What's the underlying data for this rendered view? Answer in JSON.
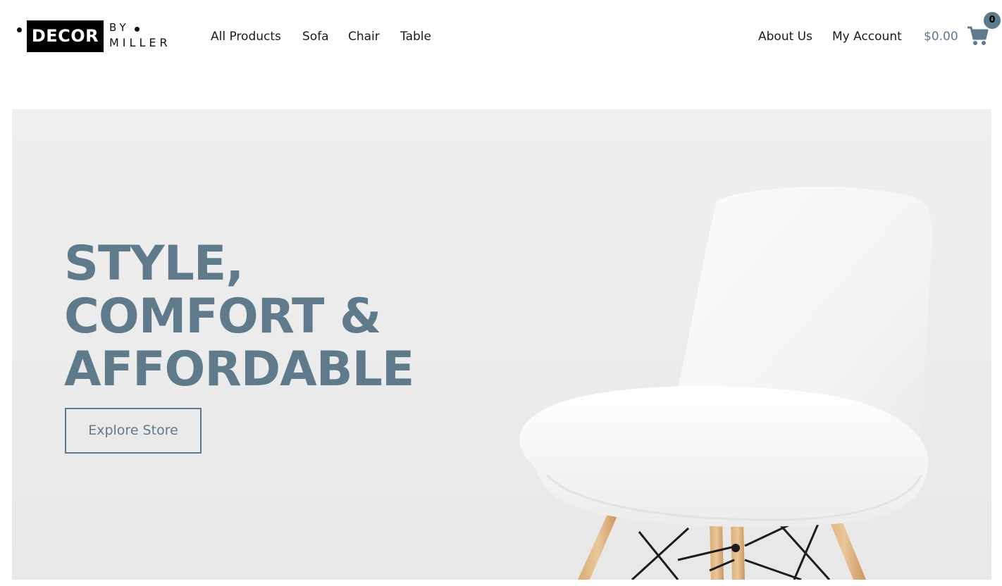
{
  "brand": {
    "logo_main": "DECOR",
    "logo_by": "BY",
    "logo_sub": "MILLER"
  },
  "nav": {
    "left_links": [
      "All Products",
      "Sofa",
      "Chair",
      "Table"
    ],
    "right_links": [
      "About Us",
      "My Account"
    ]
  },
  "cart": {
    "total": "$0.00",
    "count": "0",
    "icon": "shopping-cart-icon"
  },
  "hero": {
    "title_lines": [
      "STYLE,",
      "COMFORT &",
      "AFFORDABLE"
    ],
    "cta_label": "Explore Store"
  },
  "colors": {
    "accent": "#5e7a8b",
    "text": "#1a1a1a",
    "hero_bg": "#ececec"
  }
}
